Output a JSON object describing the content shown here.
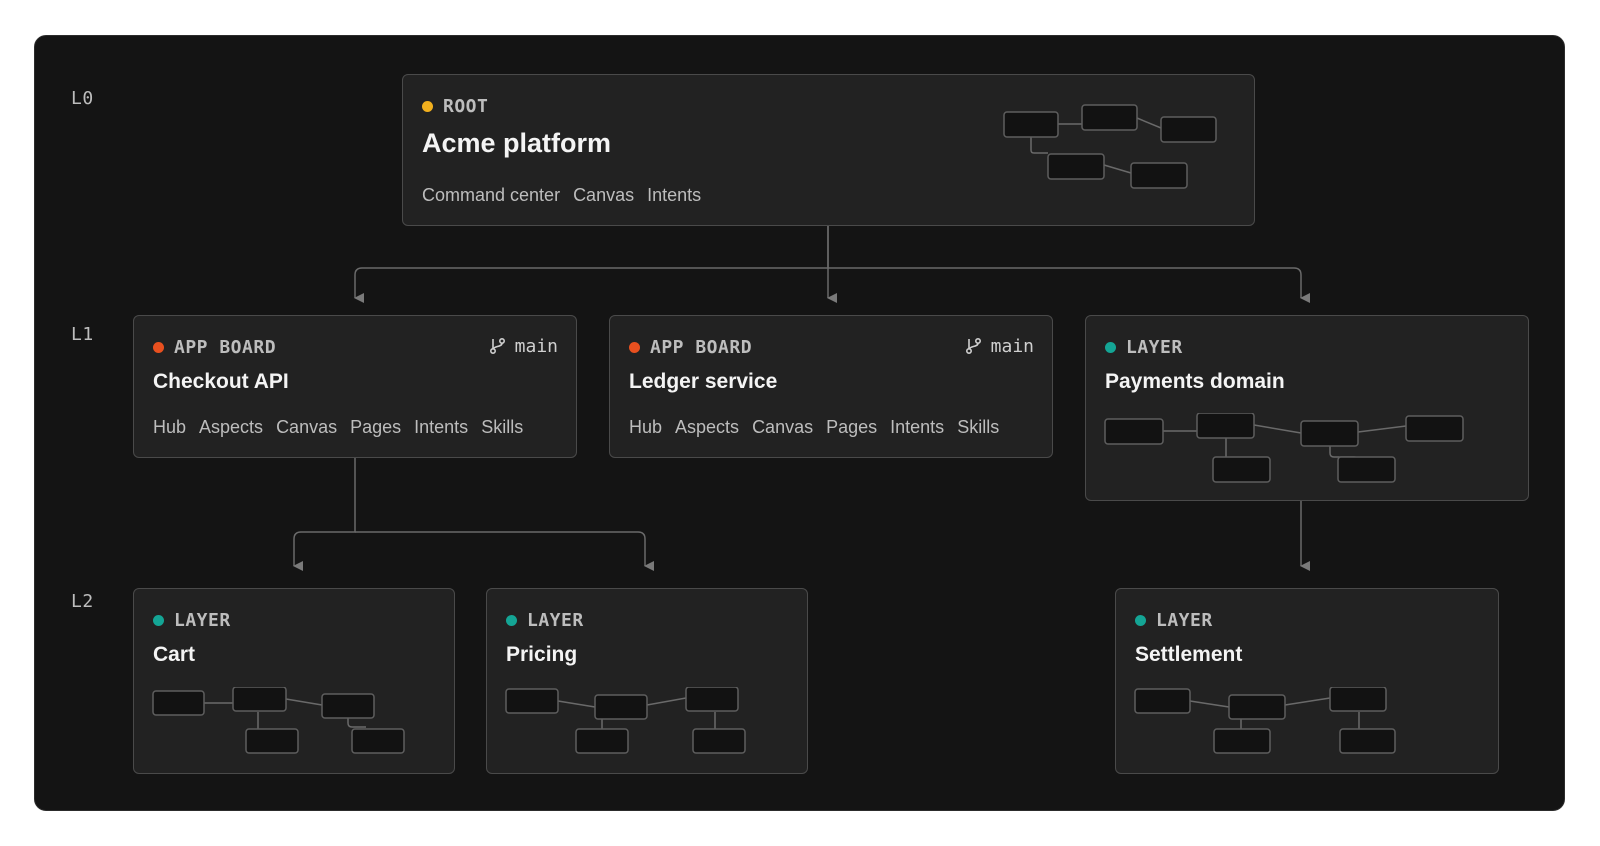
{
  "levels": [
    "L0",
    "L1",
    "L2"
  ],
  "colors": {
    "root_dot": "#f2b01e",
    "app_board_dot": "#e8501f",
    "layer_dot": "#14a595"
  },
  "root": {
    "tag": "ROOT",
    "title": "Acme platform",
    "links": [
      "Command center",
      "Canvas",
      "Intents"
    ]
  },
  "checkout": {
    "tag": "APP BOARD",
    "branch": "main",
    "title": "Checkout API",
    "links": [
      "Hub",
      "Aspects",
      "Canvas",
      "Pages",
      "Intents",
      "Skills"
    ]
  },
  "ledger": {
    "tag": "APP BOARD",
    "branch": "main",
    "title": "Ledger service",
    "links": [
      "Hub",
      "Aspects",
      "Canvas",
      "Pages",
      "Intents",
      "Skills"
    ]
  },
  "payments": {
    "tag": "LAYER",
    "title": "Payments domain"
  },
  "cart": {
    "tag": "LAYER",
    "title": "Cart"
  },
  "pricing": {
    "tag": "LAYER",
    "title": "Pricing"
  },
  "settlement": {
    "tag": "LAYER",
    "title": "Settlement"
  },
  "icons": {
    "branch": "git-branch-icon",
    "arrow": "arrow-down-icon"
  }
}
